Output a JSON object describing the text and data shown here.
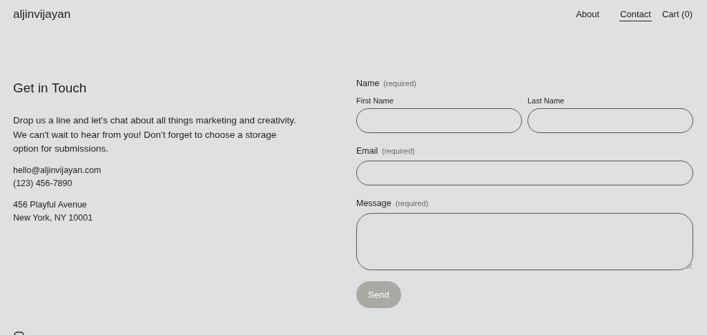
{
  "header": {
    "site_title": "aljinvijayan",
    "nav": [
      {
        "label": "About",
        "selected": false
      },
      {
        "label": "Contact",
        "selected": true
      },
      {
        "label": "Cart (0)",
        "selected": false
      }
    ]
  },
  "intro": {
    "heading": "Get in Touch",
    "body": "Drop us a line and let's chat about all things marketing and creativity. We can't wait to hear from you! Don’t forget to choose a storage option for submissions.",
    "contact_lines": [
      "hello@aljinvijayan.com",
      "(123) 456-7890"
    ],
    "address_lines": [
      "456 Playful Avenue",
      "New York, NY 10001"
    ]
  },
  "form": {
    "name": {
      "label": "Name",
      "note": "(required)",
      "first_label": "First Name",
      "last_label": "Last Name"
    },
    "email": {
      "label": "Email",
      "note": "(required)"
    },
    "message": {
      "label": "Message",
      "note": "(required)"
    },
    "submit": "Send"
  }
}
